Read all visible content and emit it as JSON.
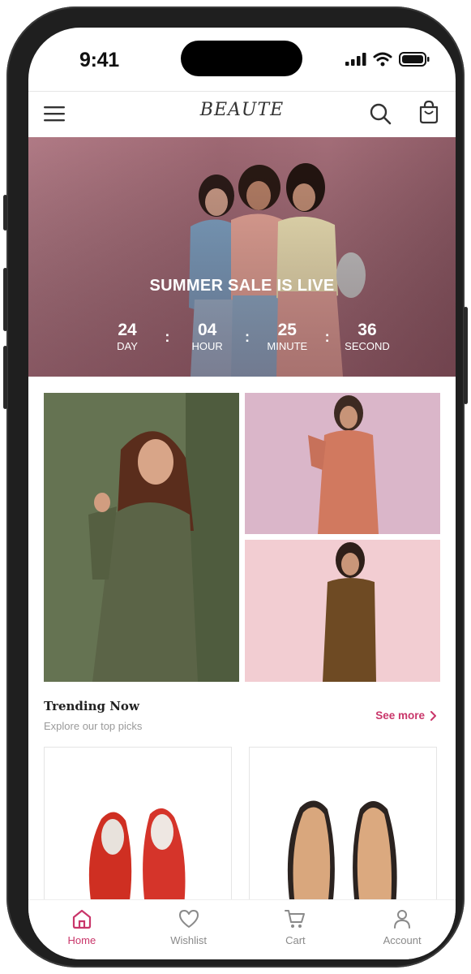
{
  "status_bar": {
    "time": "9:41"
  },
  "header": {
    "brand": "BEAUTE"
  },
  "hero": {
    "title": "SUMMER SALE IS LIVE",
    "countdown": [
      {
        "value": "24",
        "label": "DAY"
      },
      {
        "value": "04",
        "label": "HOUR"
      },
      {
        "value": "25",
        "label": "MINUTE"
      },
      {
        "value": "36",
        "label": "SECOND"
      }
    ]
  },
  "trending": {
    "title": "Trending Now",
    "subtitle": "Explore our top picks",
    "see_more": "See more"
  },
  "tabbar": {
    "items": [
      {
        "label": "Home",
        "icon": "home-icon",
        "active": true
      },
      {
        "label": "Wishlist",
        "icon": "heart-icon",
        "active": false
      },
      {
        "label": "Cart",
        "icon": "cart-icon",
        "active": false
      },
      {
        "label": "Account",
        "icon": "user-icon",
        "active": false
      }
    ]
  },
  "colors": {
    "accent": "#c9366a",
    "hero_bg": "#9e6873"
  }
}
